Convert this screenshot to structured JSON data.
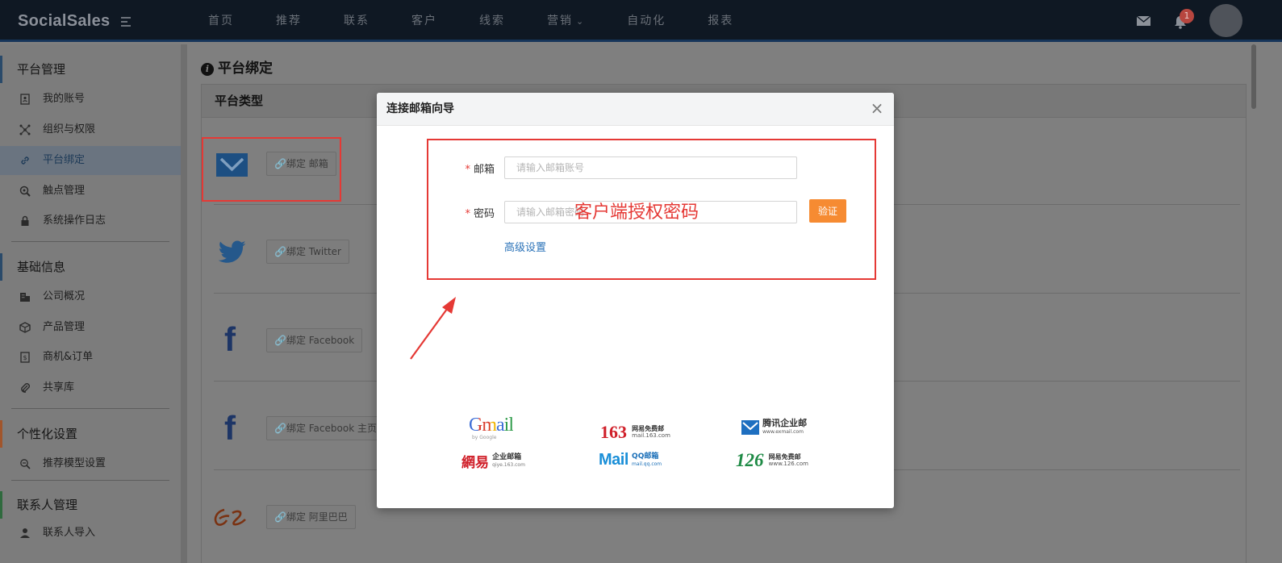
{
  "topbar": {
    "logo": "SocialSales",
    "nav": [
      "首页",
      "推荐",
      "联系",
      "客户",
      "线索",
      "营销",
      "自动化",
      "报表"
    ],
    "notification_count": "1"
  },
  "sidebar": {
    "sections": [
      {
        "title": "平台管理",
        "items": [
          "我的账号",
          "组织与权限",
          "平台绑定",
          "触点管理",
          "系统操作日志"
        ]
      },
      {
        "title": "基础信息",
        "items": [
          "公司概况",
          "产品管理",
          "商机&订单",
          "共享库"
        ]
      },
      {
        "title": "个性化设置",
        "items": [
          "推荐模型设置"
        ]
      },
      {
        "title": "联系人管理",
        "items": [
          "联系人导入"
        ]
      }
    ],
    "active_item": "平台绑定"
  },
  "main": {
    "page_title": "平台绑定",
    "panel_title": "平台类型",
    "bind_buttons": [
      "🔗绑定 邮箱",
      "🔗绑定 Twitter",
      "🔗绑定 Facebook",
      "🔗绑定 Facebook 主页",
      "🔗绑定 阿里巴巴"
    ]
  },
  "modal": {
    "title": "连接邮箱向导",
    "close": "×",
    "email_label": "邮箱",
    "email_placeholder": "请输入邮箱账号",
    "password_label": "密码",
    "password_placeholder": "请输入邮箱密码",
    "required_mark": "*",
    "annotation": "客户端授权密码",
    "verify_button": "验证",
    "advanced_link": "高级设置",
    "providers": {
      "gmail": "Gmail",
      "gmail_sub": "by Google",
      "n163": "163",
      "n163_sub1": "网易免费邮",
      "n163_sub2": "mail.163.com",
      "tencent": "腾讯企业邮",
      "tencent_sub": "www.exmail.com",
      "netease_ent": "網易",
      "netease_ent_sub1": "企业邮箱",
      "netease_ent_sub2": "qiye.163.com",
      "qq_mail": "Mail",
      "qq_sub1": "QQ邮箱",
      "qq_sub2": "mail.qq.com",
      "n126": "126",
      "n126_sub1": "网易免费邮",
      "n126_sub2": "www.126.com"
    }
  },
  "colors": {
    "accent_orange": "#f68b32",
    "annotation_red": "#e53935",
    "link_blue": "#2a72b8",
    "topbar": "#0f1823"
  }
}
